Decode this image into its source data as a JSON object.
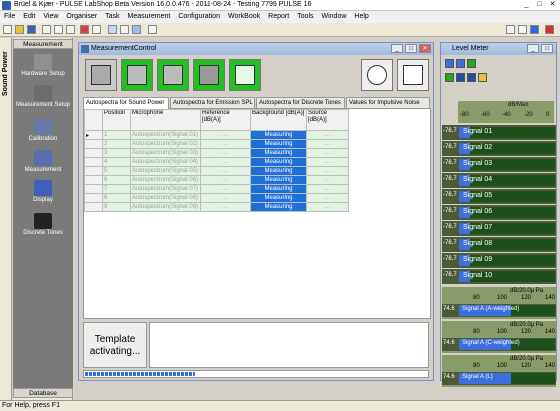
{
  "titlebar": {
    "title": "Brüel & Kjær - PULSE LabShop Beta Version 16.0.0.476 - 2011-08-24 - Testing 7799 PULSE 16",
    "min": "_",
    "max": "□",
    "close": "✕"
  },
  "menu": [
    "File",
    "Edit",
    "View",
    "Organiser",
    "Task",
    "Measurement",
    "Configuration",
    "WorkBook",
    "Report",
    "Tools",
    "Window",
    "Help"
  ],
  "leftbar": {
    "label": "Sound Power"
  },
  "nav": {
    "header": "Measurement",
    "footer": "Database",
    "items": [
      {
        "label": "Hardware Setup",
        "icon": "hardware-icon",
        "color": "#8f8f8f"
      },
      {
        "label": "Measurement Setup",
        "icon": "setup-icon",
        "color": "#6d6d6d"
      },
      {
        "label": "Calibration",
        "icon": "calibration-icon",
        "color": "#6a7aa8"
      },
      {
        "label": "Measurement",
        "icon": "measurement-icon",
        "color": "#5a6fb0"
      },
      {
        "label": "Display",
        "icon": "display-icon",
        "color": "#3f62b8"
      },
      {
        "label": "Discrete Tones",
        "icon": "discrete-tones-icon",
        "color": "#222222"
      }
    ]
  },
  "mc": {
    "title": "MeasurementControl",
    "tabs": [
      "Autospectra for Sound Power",
      "Autospectra for Emission SPL",
      "Autospectra for Discrete Tones",
      "Values for Impulsive Noise"
    ],
    "columns": [
      "",
      "Position",
      "Microphone",
      "Reference [dB(A)]",
      "Background [dB(A)]",
      "Source [dB(A)]"
    ],
    "rows": [
      {
        "pos": "1",
        "mic": "Autospectrum(Signal 01)",
        "ref": "...",
        "bg": "Measuring",
        "src": "..."
      },
      {
        "pos": "2",
        "mic": "Autospectrum(Signal 02)",
        "ref": "...",
        "bg": "Measuring",
        "src": "..."
      },
      {
        "pos": "3",
        "mic": "Autospectrum(Signal 03)",
        "ref": "...",
        "bg": "Measuring",
        "src": "..."
      },
      {
        "pos": "4",
        "mic": "Autospectrum(Signal 04)",
        "ref": "...",
        "bg": "Measuring",
        "src": "..."
      },
      {
        "pos": "5",
        "mic": "Autospectrum(Signal 05)",
        "ref": "...",
        "bg": "Measuring",
        "src": "..."
      },
      {
        "pos": "6",
        "mic": "Autospectrum(Signal 06)",
        "ref": "...",
        "bg": "Measuring",
        "src": "..."
      },
      {
        "pos": "7",
        "mic": "Autospectrum(Signal 07)",
        "ref": "...",
        "bg": "Measuring",
        "src": "..."
      },
      {
        "pos": "8",
        "mic": "Autospectrum(Signal 08)",
        "ref": "...",
        "bg": "Measuring",
        "src": "..."
      },
      {
        "pos": "9",
        "mic": "Autospectrum(Signal 09)",
        "ref": "...",
        "bg": "Measuring",
        "src": "..."
      }
    ],
    "template_status": "Template activating...",
    "progress": 0.32,
    "colors": {
      "measuring": "#1f6fd8",
      "row_green": "#e1f2e1",
      "button_green": "#22c022"
    }
  },
  "level_meter": {
    "title": "Level Meter",
    "scale_unit": "dB/Max",
    "scale_ticks": [
      "-80",
      "-60",
      "-40",
      "-20",
      "0"
    ],
    "channels": [
      {
        "value": "-76.7",
        "label": "Signal 01",
        "level": 0.05
      },
      {
        "value": "-76.7",
        "label": "Signal 02",
        "level": 0.05
      },
      {
        "value": "-76.7",
        "label": "Signal 03",
        "level": 0.05
      },
      {
        "value": "-76.7",
        "label": "Signal 04",
        "level": 0.05
      },
      {
        "value": "-76.7",
        "label": "Signal 05",
        "level": 0.05
      },
      {
        "value": "-76.7",
        "label": "Signal 06",
        "level": 0.05
      },
      {
        "value": "-76.7",
        "label": "Signal 07",
        "level": 0.05
      },
      {
        "value": "-76.7",
        "label": "Signal 08",
        "level": 0.05
      },
      {
        "value": "-76.7",
        "label": "Signal 09",
        "level": 0.05
      },
      {
        "value": "-76.7",
        "label": "Signal 10",
        "level": 0.05
      }
    ],
    "weighted": [
      {
        "unit": "dB/20.0μ Pa",
        "ticks": [
          "80",
          "100",
          "120",
          "140"
        ],
        "value": "74.6",
        "label": "Signal A (A-weighted)"
      },
      {
        "unit": "dB/20.0μ Pa",
        "ticks": [
          "80",
          "100",
          "120",
          "140"
        ],
        "value": "74.6",
        "label": "Signal A (C-weighted)"
      },
      {
        "unit": "dB/20.0μ Pa",
        "ticks": [
          "80",
          "100",
          "120",
          "140"
        ],
        "value": "74.6",
        "label": "Signal A (L)"
      }
    ]
  },
  "status": {
    "text": "For Help, press F1"
  }
}
